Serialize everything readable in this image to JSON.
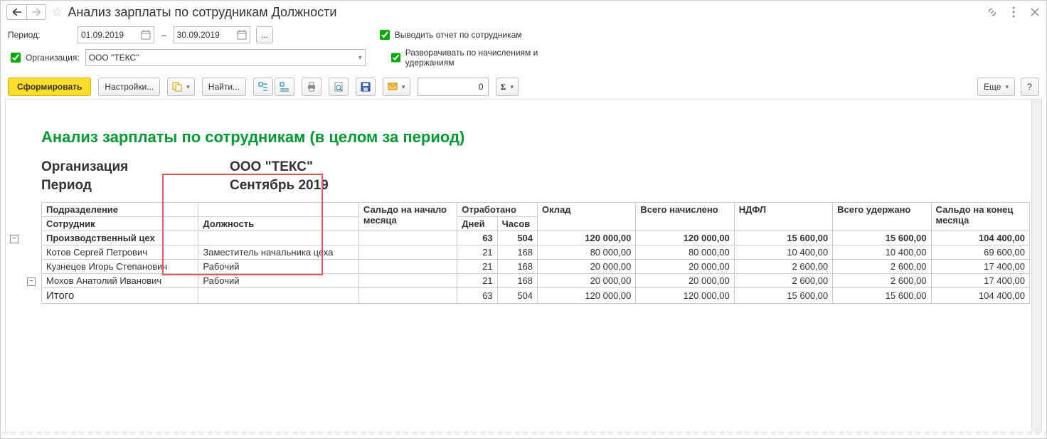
{
  "title": "Анализ зарплаты по сотрудникам Должности",
  "filters": {
    "period_label": "Период:",
    "date_from": "01.09.2019",
    "date_to": "30.09.2019",
    "ellipsis": "...",
    "org_check_label": "Организация:",
    "org_value": "ООО \"ТЕКС\"",
    "chk_by_employee": "Выводить отчет по сотрудникам",
    "chk_expand": "Разворачивать по начислениям и удержаниям"
  },
  "toolbar": {
    "run": "Сформировать",
    "settings": "Настройки...",
    "find": "Найти...",
    "num_value": "0",
    "more": "Еще",
    "help": "?"
  },
  "report": {
    "title": "Анализ зарплаты по сотрудникам (в целом за период)",
    "org_k": "Организация",
    "org_v": "ООО \"ТЕКС\"",
    "period_k": "Период",
    "period_v": "Сентябрь 2019",
    "headers": {
      "dept": "Подразделение",
      "emp": "Сотрудник",
      "pos": "Должность",
      "saldo_begin": "Сальдо на начало месяца",
      "worked": "Отработано",
      "days": "Дней",
      "hours": "Часов",
      "salary": "Оклад",
      "accrued": "Всего начислено",
      "ndfl": "НДФЛ",
      "withheld": "Всего удержано",
      "saldo_end": "Сальдо на конец месяца"
    },
    "rows": [
      {
        "name": "Производственный цех",
        "pos": "",
        "days": "63",
        "hours": "504",
        "salary": "120 000,00",
        "accrued": "120 000,00",
        "ndfl": "15 600,00",
        "withheld": "15 600,00",
        "end": "104 400,00",
        "bold": true
      },
      {
        "name": "Котов Сергей Петрович",
        "pos": "Заместитель начальника цеха",
        "days": "21",
        "hours": "168",
        "salary": "80 000,00",
        "accrued": "80 000,00",
        "ndfl": "10 400,00",
        "withheld": "10 400,00",
        "end": "69 600,00"
      },
      {
        "name": "Кузнецов Игорь Степанович",
        "pos": "Рабочий",
        "days": "21",
        "hours": "168",
        "salary": "20 000,00",
        "accrued": "20 000,00",
        "ndfl": "2 600,00",
        "withheld": "2 600,00",
        "end": "17 400,00"
      },
      {
        "name": "Мохов Анатолий Иванович",
        "pos": "Рабочий",
        "days": "21",
        "hours": "168",
        "salary": "20 000,00",
        "accrued": "20 000,00",
        "ndfl": "2 600,00",
        "withheld": "2 600,00",
        "end": "17 400,00"
      }
    ],
    "total": {
      "name": "Итого",
      "days": "63",
      "hours": "504",
      "salary": "120 000,00",
      "accrued": "120 000,00",
      "ndfl": "15 600,00",
      "withheld": "15 600,00",
      "end": "104 400,00"
    }
  }
}
